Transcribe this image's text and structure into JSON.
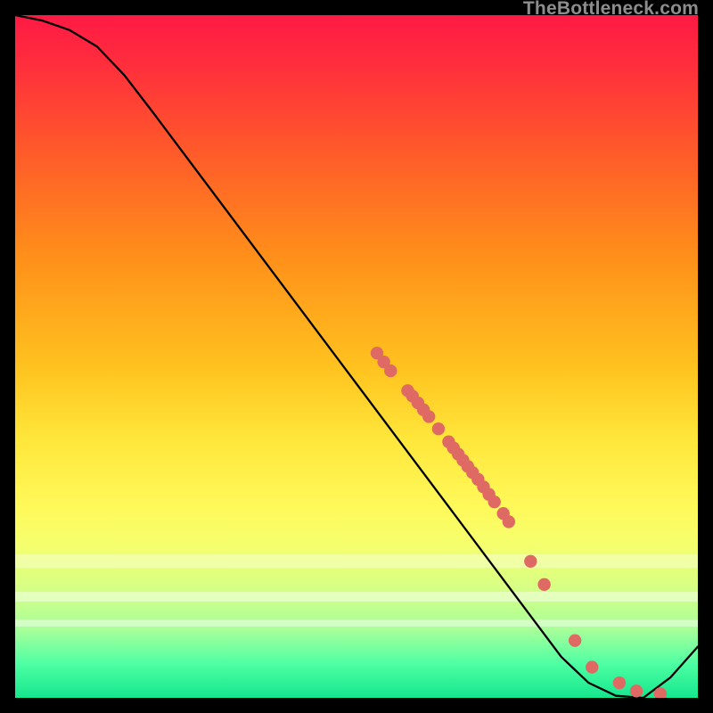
{
  "watermark": "TheBottleneck.com",
  "chart_data": {
    "type": "line",
    "title": "",
    "xlabel": "",
    "ylabel": "",
    "xlim": [
      0,
      100
    ],
    "ylim": [
      0,
      100
    ],
    "curve": [
      {
        "x": 0,
        "y": 100
      },
      {
        "x": 4,
        "y": 99.2
      },
      {
        "x": 8,
        "y": 97.8
      },
      {
        "x": 12,
        "y": 95.4
      },
      {
        "x": 16,
        "y": 91.2
      },
      {
        "x": 20,
        "y": 86.0
      },
      {
        "x": 80,
        "y": 6.0
      },
      {
        "x": 84,
        "y": 2.2
      },
      {
        "x": 88,
        "y": 0.3
      },
      {
        "x": 92,
        "y": 0.0
      },
      {
        "x": 96,
        "y": 3.0
      },
      {
        "x": 100,
        "y": 7.5
      }
    ],
    "markers": [
      {
        "x": 53.0,
        "y": 50.5
      },
      {
        "x": 54.0,
        "y": 49.2
      },
      {
        "x": 55.0,
        "y": 47.9
      },
      {
        "x": 57.5,
        "y": 45.0
      },
      {
        "x": 58.2,
        "y": 44.2
      },
      {
        "x": 59.0,
        "y": 43.2
      },
      {
        "x": 59.8,
        "y": 42.2
      },
      {
        "x": 60.6,
        "y": 41.2
      },
      {
        "x": 62.0,
        "y": 39.4
      },
      {
        "x": 63.5,
        "y": 37.5
      },
      {
        "x": 64.2,
        "y": 36.6
      },
      {
        "x": 64.9,
        "y": 35.7
      },
      {
        "x": 65.6,
        "y": 34.8
      },
      {
        "x": 66.3,
        "y": 33.9
      },
      {
        "x": 67.0,
        "y": 33.0
      },
      {
        "x": 67.8,
        "y": 32.0
      },
      {
        "x": 68.6,
        "y": 30.9
      },
      {
        "x": 69.4,
        "y": 29.8
      },
      {
        "x": 70.2,
        "y": 28.7
      },
      {
        "x": 71.5,
        "y": 27.0
      },
      {
        "x": 72.3,
        "y": 25.8
      },
      {
        "x": 75.5,
        "y": 20.0
      },
      {
        "x": 77.5,
        "y": 16.6
      },
      {
        "x": 82.0,
        "y": 8.4
      },
      {
        "x": 84.5,
        "y": 4.5
      },
      {
        "x": 88.5,
        "y": 2.2
      },
      {
        "x": 91.0,
        "y": 1.0
      },
      {
        "x": 94.5,
        "y": 0.6
      }
    ],
    "white_bands": [
      {
        "y": 79.0,
        "h": 1.9,
        "alpha": 0.35
      },
      {
        "y": 84.5,
        "h": 1.4,
        "alpha": 0.45
      },
      {
        "y": 88.5,
        "h": 1.1,
        "alpha": 0.45
      }
    ],
    "marker_color": "#df6a63",
    "marker_stroke": "#ba4f46",
    "line_color": "#000000"
  }
}
